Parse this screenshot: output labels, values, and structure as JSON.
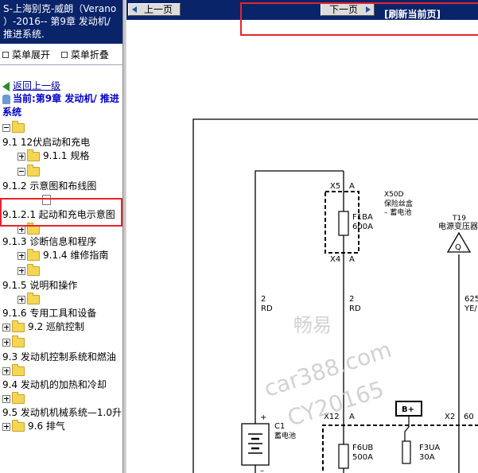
{
  "left_pane": {
    "title": "S-上海别克-威朗（Verano ）-2016-- 第9章 发动机/ 推进系统.",
    "menu_expand": "菜单展开",
    "menu_collapse": "菜单折叠",
    "back_link": "返回上一级",
    "current": "当前:第9章 发动机/ 推进系统",
    "tree": [
      {
        "label": "9.1 12伏启动和充电"
      },
      {
        "label": "9.1.1 规格"
      },
      {
        "label": "9.1.2 示意图和布线图"
      },
      {
        "label": "9.1.2.1 起动和充电示意图"
      },
      {
        "label": "9.1.3 诊断信息和程序"
      },
      {
        "label": "9.1.4 维修指南"
      },
      {
        "label": "9.1.5 说明和操作"
      },
      {
        "label": "9.1.6 专用工具和设备"
      },
      {
        "label": "9.2 巡航控制"
      },
      {
        "label": "9.3 发动机控制系统和燃油"
      },
      {
        "label": "9.4 发动机的加热和冷却"
      },
      {
        "label": "9.5 发动机机械系统—1.0升"
      },
      {
        "label": "9.6 排气"
      }
    ]
  },
  "nav": {
    "prev_label": "上一页",
    "next_label": "下一页",
    "refresh_label": "[刷新当前页]"
  },
  "diagram": {
    "x5": "X5",
    "x5_pin": "A",
    "x50d": "X50D",
    "x50d_desc1": "保险丝盒",
    "x50d_desc2": "– 蓄电池",
    "fuse1_name": "F1BA",
    "fuse1_rating": "600A",
    "x4": "X4",
    "x4_pin": "A",
    "t19": "T19",
    "t19_desc": "电源变压器",
    "t19_symbol": "Q",
    "wire1_size": "2",
    "wire1_color": "RD",
    "wire2_size": "2",
    "wire2_color": "RD",
    "wire3_size": "625",
    "wire3_color": "YE/",
    "x12": "X12",
    "x12_pin": "A",
    "bplus": "B+",
    "x2": "X2",
    "x2_pin": "60",
    "c1": "C1",
    "c1_desc": "蓄电池",
    "c1_plus": "+",
    "c1_minus": "–",
    "fuse2_name": "F6UB",
    "fuse2_rating": "500A",
    "fuse3_name": "F3UA",
    "fuse3_rating": "30A",
    "watermark1": "畅易",
    "watermark2": "car388.com",
    "watermark3": "CY20165"
  }
}
